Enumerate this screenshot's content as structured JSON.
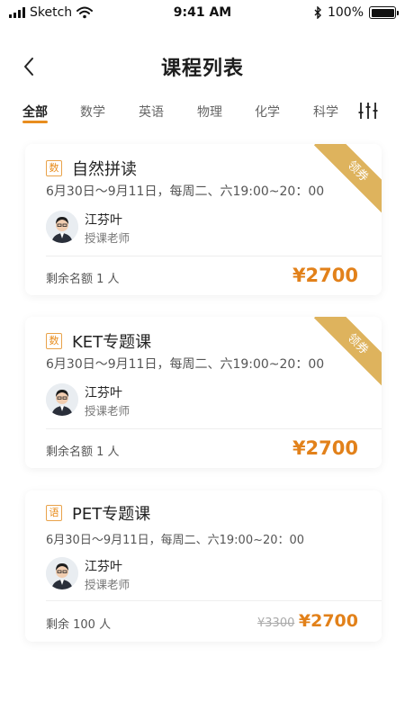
{
  "status_bar": {
    "carrier": "Sketch",
    "time": "9:41 AM",
    "battery": "100%",
    "battery_level": 1.0
  },
  "header": {
    "title": "课程列表",
    "back_icon": "chevron-left-icon"
  },
  "tabs": [
    {
      "label": "全部",
      "active": true
    },
    {
      "label": "数学",
      "active": false
    },
    {
      "label": "英语",
      "active": false
    },
    {
      "label": "物理",
      "active": false
    },
    {
      "label": "化学",
      "active": false
    },
    {
      "label": "科学",
      "active": false
    }
  ],
  "filter_icon": "sliders-icon",
  "courses": [
    {
      "subject": "数",
      "title": "自然拼读",
      "schedule": "6月30日～9月11日，每周二、六19:00~20：00",
      "teacher": "江芬叶",
      "teacher_role": "授课老师",
      "remaining": "剩余名额 1 人",
      "price": "¥2700",
      "ribbon": "领券"
    },
    {
      "subject": "数",
      "title": "KET专题课",
      "schedule": "6月30日～9月11日，每周二、六19:00~20：00",
      "teacher": "江芬叶",
      "teacher_role": "授课老师",
      "remaining": "剩余名额 1 人",
      "price": "¥2700",
      "ribbon": "领券"
    },
    {
      "subject": "语",
      "title": "PET专题课",
      "schedule": "6月30日～9月11日，每周二、六19:00~20：00",
      "teacher": "江芬叶",
      "teacher_role": "授课老师",
      "remaining": "剩余 100 人",
      "original_price": "¥3300",
      "price": "¥2700"
    }
  ],
  "colors": {
    "accent": "#e88d1e",
    "price": "#e2811a",
    "ribbon": "#deb35d"
  }
}
